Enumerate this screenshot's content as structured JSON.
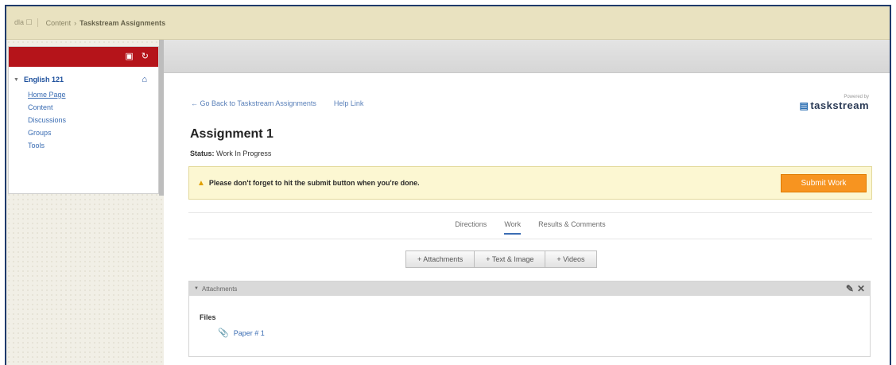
{
  "topbar": {
    "course_button": "dla ☐",
    "crumb_root": "Content",
    "crumb_sep": "›",
    "crumb_current": "Taskstream Assignments"
  },
  "leftmenu": {
    "course_name": "English 121",
    "items": [
      {
        "label": "Home Page"
      },
      {
        "label": "Content"
      },
      {
        "label": "Discussions"
      },
      {
        "label": "Groups"
      },
      {
        "label": "Tools"
      }
    ]
  },
  "links": {
    "back": "← Go Back to Taskstream Assignments",
    "help": "Help Link"
  },
  "powered": {
    "by": "Powered by",
    "brand": "taskstream"
  },
  "assignment": {
    "title": "Assignment 1",
    "status_label": "Status:",
    "status_value": "Work In Progress"
  },
  "alert": {
    "message": "Please don't forget to hit the submit button when you're done.",
    "submit_label": "Submit Work"
  },
  "tabs": [
    {
      "label": "Directions"
    },
    {
      "label": "Work"
    },
    {
      "label": "Results & Comments"
    }
  ],
  "add_buttons": [
    {
      "label": "+ Attachments"
    },
    {
      "label": "+ Text & Image"
    },
    {
      "label": "+ Videos"
    }
  ],
  "attachments": {
    "header": "Attachments",
    "files_label": "Files",
    "files": [
      {
        "name": "Paper # 1"
      }
    ]
  },
  "colors": {
    "accent_red": "#b5141a",
    "submit_orange": "#f79420",
    "link_blue": "#3b6db3"
  }
}
